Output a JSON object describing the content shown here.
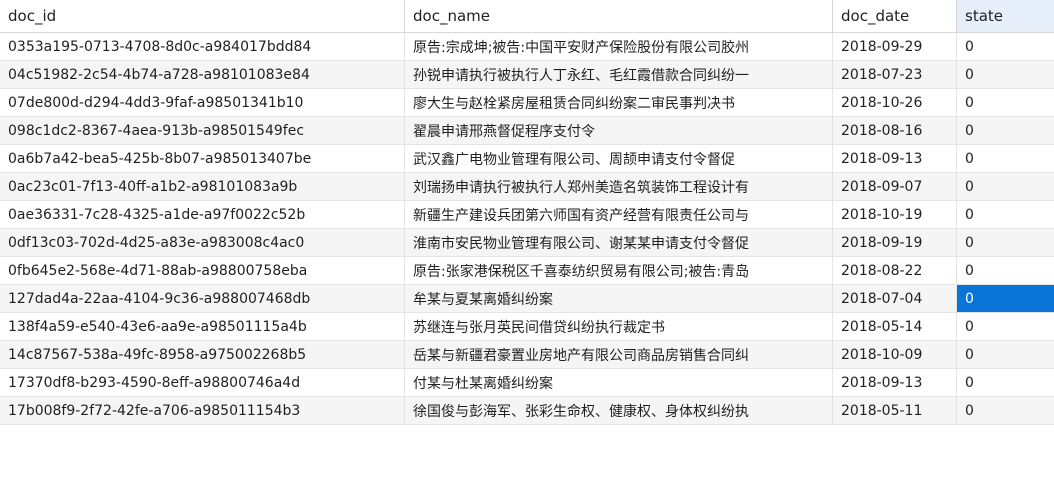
{
  "columns": {
    "doc_id": "doc_id",
    "doc_name": "doc_name",
    "doc_date": "doc_date",
    "state": "state"
  },
  "rows": [
    {
      "doc_id": "0353a195-0713-4708-8d0c-a984017bdd84",
      "doc_name": "原告:宗成坤;被告:中国平安财产保险股份有限公司胶州",
      "doc_date": "2018-09-29",
      "state": "0"
    },
    {
      "doc_id": "04c51982-2c54-4b74-a728-a98101083e84",
      "doc_name": "孙锐申请执行被执行人丁永红、毛红霞借款合同纠纷一",
      "doc_date": "2018-07-23",
      "state": "0"
    },
    {
      "doc_id": "07de800d-d294-4dd3-9faf-a98501341b10",
      "doc_name": "廖大生与赵栓紧房屋租赁合同纠纷案二审民事判决书",
      "doc_date": "2018-10-26",
      "state": "0"
    },
    {
      "doc_id": "098c1dc2-8367-4aea-913b-a98501549fec",
      "doc_name": "翟晨申请邢燕督促程序支付令",
      "doc_date": "2018-08-16",
      "state": "0"
    },
    {
      "doc_id": "0a6b7a42-bea5-425b-8b07-a985013407be",
      "doc_name": "武汉鑫广电物业管理有限公司、周颉申请支付令督促",
      "doc_date": "2018-09-13",
      "state": "0"
    },
    {
      "doc_id": "0ac23c01-7f13-40ff-a1b2-a98101083a9b",
      "doc_name": "刘瑞扬申请执行被执行人郑州美造名筑装饰工程设计有",
      "doc_date": "2018-09-07",
      "state": "0"
    },
    {
      "doc_id": "0ae36331-7c28-4325-a1de-a97f0022c52b",
      "doc_name": "新疆生产建设兵团第六师国有资产经营有限责任公司与",
      "doc_date": "2018-10-19",
      "state": "0"
    },
    {
      "doc_id": "0df13c03-702d-4d25-a83e-a983008c4ac0",
      "doc_name": "淮南市安民物业管理有限公司、谢某某申请支付令督促",
      "doc_date": "2018-09-19",
      "state": "0"
    },
    {
      "doc_id": "0fb645e2-568e-4d71-88ab-a98800758eba",
      "doc_name": "原告:张家港保税区千喜泰纺织贸易有限公司;被告:青岛",
      "doc_date": "2018-08-22",
      "state": "0"
    },
    {
      "doc_id": "127dad4a-22aa-4104-9c36-a988007468db",
      "doc_name": "牟某与夏某离婚纠纷案",
      "doc_date": "2018-07-04",
      "state": "0",
      "selected": true
    },
    {
      "doc_id": "138f4a59-e540-43e6-aa9e-a98501115a4b",
      "doc_name": "苏继连与张月英民间借贷纠纷执行裁定书",
      "doc_date": "2018-05-14",
      "state": "0"
    },
    {
      "doc_id": "14c87567-538a-49fc-8958-a975002268b5",
      "doc_name": "岳某与新疆君豪置业房地产有限公司商品房销售合同纠",
      "doc_date": "2018-10-09",
      "state": "0"
    },
    {
      "doc_id": "17370df8-b293-4590-8eff-a98800746a4d",
      "doc_name": "付某与杜某离婚纠纷案",
      "doc_date": "2018-09-13",
      "state": "0"
    },
    {
      "doc_id": "17b008f9-2f72-42fe-a706-a985011154b3",
      "doc_name": "徐国俊与彭海军、张彩生命权、健康权、身体权纠纷执",
      "doc_date": "2018-05-11",
      "state": "0"
    }
  ]
}
